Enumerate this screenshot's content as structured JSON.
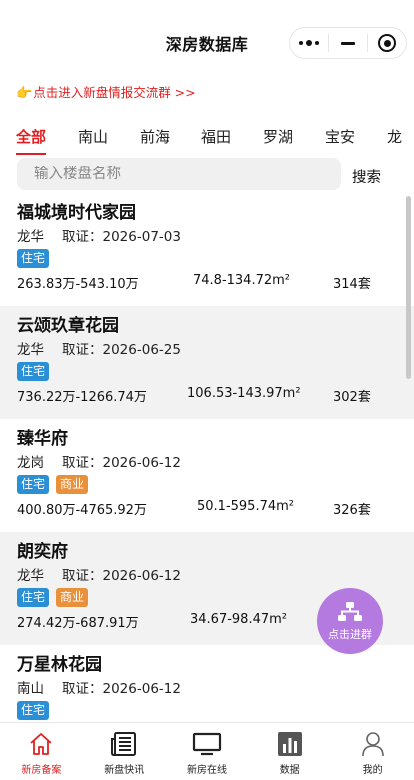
{
  "header": {
    "title": "深房数据库"
  },
  "banner": {
    "text": "点击进入新盘情报交流群 >>",
    "icon": "pointing-hand-icon"
  },
  "tabs": [
    "全部",
    "南山",
    "前海",
    "福田",
    "罗湖",
    "宝安",
    "龙"
  ],
  "active_tab": "全部",
  "search": {
    "placeholder": "输入楼盘名称",
    "value": "",
    "button": "搜索"
  },
  "cert_prefix": "取证：",
  "listings": [
    {
      "name": "福城境时代家园",
      "district": "龙华",
      "cert_date": "2026-07-03",
      "tags": [
        "住宅"
      ],
      "price": "263.83万-543.10万",
      "area": "74.8-134.72m²",
      "units": "314套"
    },
    {
      "name": "云颂玖章花园",
      "district": "龙华",
      "cert_date": "2026-06-25",
      "tags": [
        "住宅"
      ],
      "price": "736.22万-1266.74万",
      "area": "106.53-143.97m²",
      "units": "302套"
    },
    {
      "name": "臻华府",
      "district": "龙岗",
      "cert_date": "2026-06-12",
      "tags": [
        "住宅",
        "商业"
      ],
      "price": "400.80万-4765.92万",
      "area": "50.1-595.74m²",
      "units": "326套"
    },
    {
      "name": "朗奕府",
      "district": "龙华",
      "cert_date": "2026-06-12",
      "tags": [
        "住宅",
        "商业"
      ],
      "price": "274.42万-687.91万",
      "area": "34.67-98.47m²",
      "units": ""
    },
    {
      "name": "万星林花园",
      "district": "南山",
      "cert_date": "2026-06-12",
      "tags": [
        "住宅"
      ],
      "price": "",
      "area": "",
      "units": ""
    }
  ],
  "fab": {
    "label": "点击进群",
    "icon": "org-chart-icon"
  },
  "bottom_nav": [
    {
      "label": "新房备案",
      "icon": "home-icon",
      "active": true
    },
    {
      "label": "新盘快讯",
      "icon": "newspaper-icon",
      "active": false
    },
    {
      "label": "新房在线",
      "icon": "monitor-icon",
      "active": false
    },
    {
      "label": "数据",
      "icon": "bar-chart-icon",
      "active": false
    },
    {
      "label": "我的",
      "icon": "user-icon",
      "active": false
    }
  ],
  "colors": {
    "accent": "#e02020",
    "tag_residential": "#2b8fd6",
    "tag_commercial": "#e8913a",
    "fab": "#b47ae0"
  }
}
